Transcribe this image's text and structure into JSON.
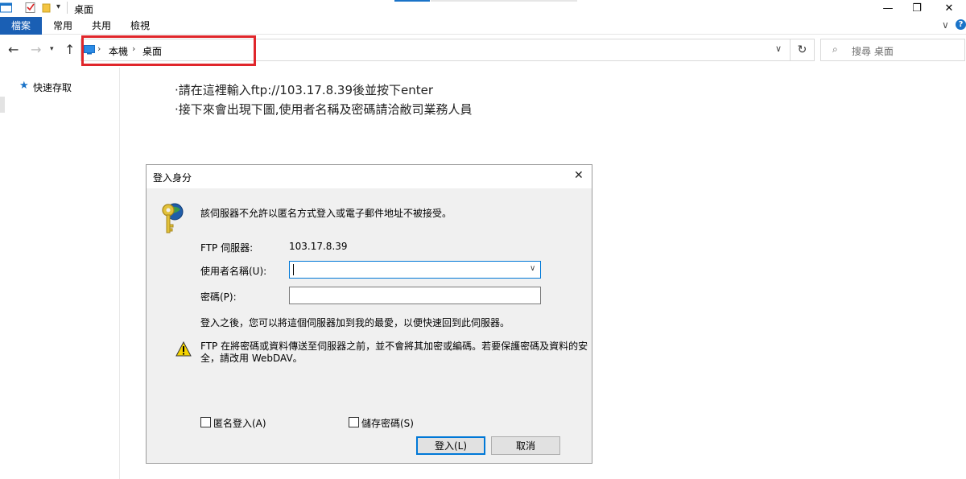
{
  "window": {
    "title": "桌面",
    "controls": {
      "minimize": "—",
      "restore": "❐",
      "close": "✕"
    }
  },
  "ribbon": {
    "tabs": [
      "檔案",
      "常用",
      "共用",
      "檢視"
    ],
    "help": "?"
  },
  "address": {
    "crumbs": [
      "本機",
      "桌面"
    ],
    "search_placeholder": "搜尋 桌面"
  },
  "sidebar": {
    "quick_access": "快速存取"
  },
  "notes": {
    "line1": "·請在這裡輸入ftp://103.17.8.39後並按下enter",
    "line2": "·接下來會出現下圖,使用者名稱及密碼請洽敝司業務人員"
  },
  "dialog": {
    "title": "登入身分",
    "message": "該伺服器不允許以匿名方式登入或電子郵件地址不被接受。",
    "server_label": "FTP 伺服器:",
    "server_value": "103.17.8.39",
    "username_label": "使用者名稱(U):",
    "password_label": "密碼(P):",
    "info": "登入之後，您可以將這個伺服器加到我的最愛，以便快速回到此伺服器。",
    "warning_line1": "FTP 在將密碼或資料傳送至伺服器之前，並不會將其加密或編碼。若要保護密碼及資料的安",
    "warning_line2": "全，請改用 WebDAV。",
    "anonymous_label": "匿名登入(A)",
    "save_password_label": "儲存密碼(S)",
    "login_button": "登入(L)",
    "cancel_button": "取消"
  },
  "colors": {
    "file_tab": "#1a5fb4",
    "highlight_frame": "#e0262b",
    "dialog_bg": "#f0f0f0"
  }
}
